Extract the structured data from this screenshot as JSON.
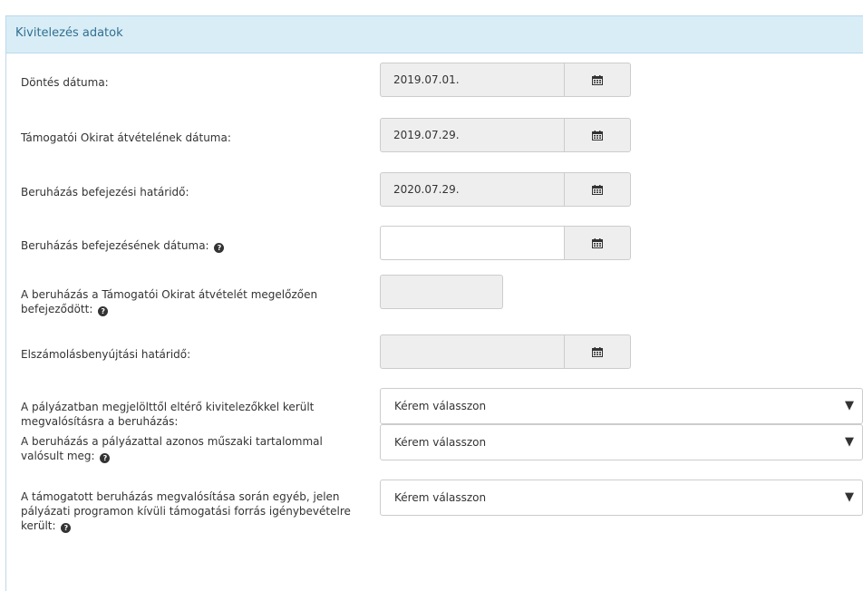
{
  "panel": {
    "title": "Kivitelezés adatok"
  },
  "fields": {
    "dontes": {
      "label": "Döntés dátuma:",
      "value": "2019.07.01."
    },
    "okirat": {
      "label": "Támogatói Okirat átvételének dátuma:",
      "value": "2019.07.29."
    },
    "hatarido": {
      "label": "Beruházás befejezési határidő:",
      "value": "2020.07.29."
    },
    "befejezes": {
      "label": "Beruházás befejezésének dátuma:",
      "value": ""
    },
    "megelozoen": {
      "label": "A beruházás a Támogatói Okirat átvételét megelőzően befejeződött:"
    },
    "elszamolas": {
      "label": "Elszámolásbenyújtási határidő:",
      "value": ""
    },
    "kivitelezo": {
      "label": "A pályázatban megjelölttől eltérő kivitelezőkkel került megvalósításra a beruházás:",
      "selected": "Kérem válasszon"
    },
    "muszaki": {
      "label": "A beruházás a pályázattal azonos műszaki tartalommal valósult meg:",
      "selected": "Kérem válasszon"
    },
    "egyeb": {
      "label": "A támogatott beruházás megvalósítása során egyéb, jelen pályázati programon kívüli támogatási forrás igénybevételre került:",
      "selected": "Kérem válasszon"
    }
  },
  "icons": {
    "calendar": "calendar-icon",
    "help": "question-circle-icon",
    "caret": "caret-down-icon"
  },
  "glyphs": {
    "help": "?",
    "caret": "▼"
  },
  "colors": {
    "header_bg": "#d9edf7",
    "header_text": "#31708f",
    "disabled_bg": "#eeeeee",
    "border": "#cccccc"
  }
}
